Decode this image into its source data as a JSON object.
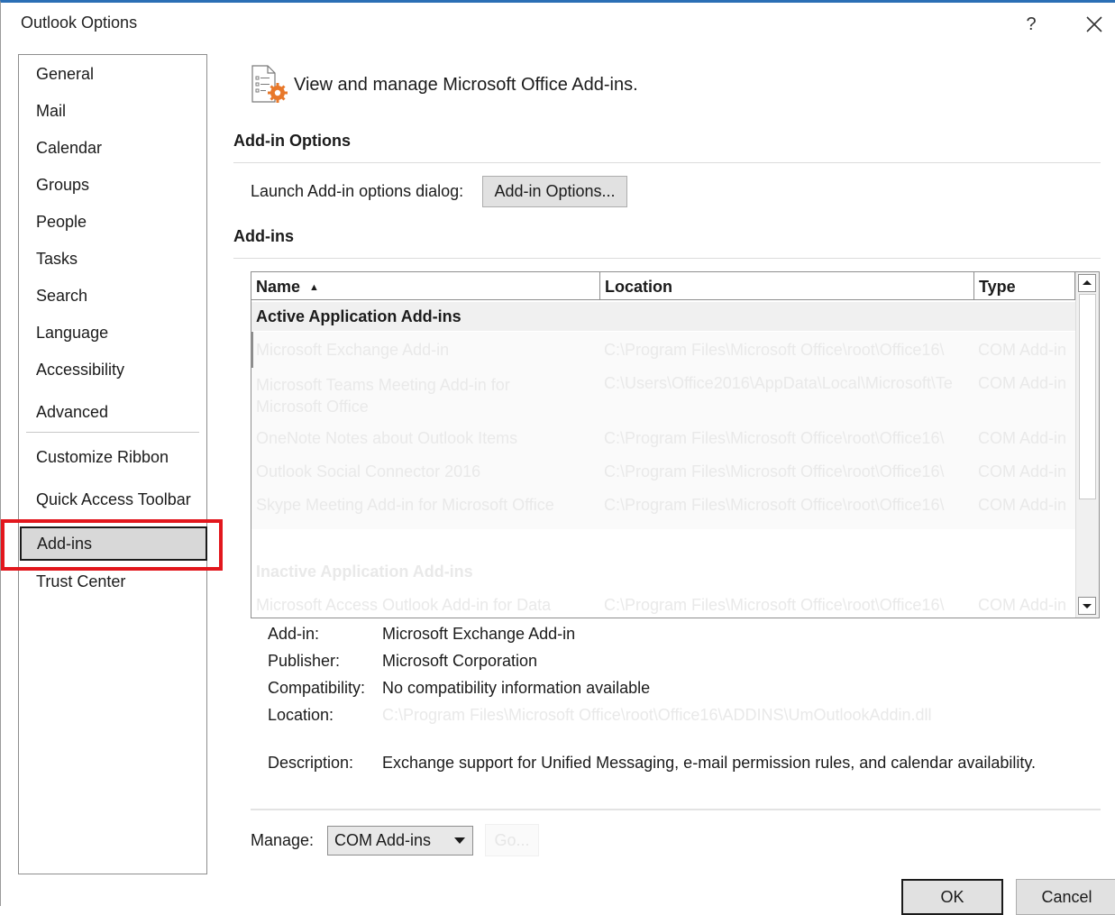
{
  "window": {
    "title": "Outlook Options",
    "help_label": "?",
    "close_label": "✕"
  },
  "nav": {
    "items": [
      {
        "label": "General"
      },
      {
        "label": "Mail"
      },
      {
        "label": "Calendar"
      },
      {
        "label": "Groups"
      },
      {
        "label": "People"
      },
      {
        "label": "Tasks"
      },
      {
        "label": "Search"
      },
      {
        "label": "Language"
      },
      {
        "label": "Accessibility"
      },
      {
        "label": "Advanced"
      },
      {
        "label": "Customize Ribbon"
      },
      {
        "label": "Quick Access Toolbar"
      },
      {
        "label": "Add-ins"
      },
      {
        "label": "Trust Center"
      }
    ],
    "selected": "Add-ins"
  },
  "header": {
    "text": "View and manage Microsoft Office Add-ins."
  },
  "addin_options": {
    "section_title": "Add-in Options",
    "launch_label": "Launch Add-in options dialog:",
    "button_label": "Add-in Options..."
  },
  "addins": {
    "section_title": "Add-ins",
    "columns": [
      "Name",
      "Location",
      "Type"
    ],
    "sort_indicator": "▲",
    "groups": [
      {
        "title": "Active Application Add-ins",
        "rows": [
          {
            "name": "Microsoft Exchange Add-in",
            "location": "C:\\Program Files\\Microsoft Office\\root\\Office16\\",
            "type": "COM Add-in"
          },
          {
            "name": "Microsoft Teams Meeting Add-in for Microsoft Office",
            "location": "C:\\Users\\Office2016\\AppData\\Local\\Microsoft\\Te",
            "type": "COM Add-in"
          },
          {
            "name": "OneNote Notes about Outlook Items",
            "location": "C:\\Program Files\\Microsoft Office\\root\\Office16\\",
            "type": "COM Add-in"
          },
          {
            "name": "Outlook Social Connector 2016",
            "location": "C:\\Program Files\\Microsoft Office\\root\\Office16\\",
            "type": "COM Add-in"
          },
          {
            "name": "Skype Meeting Add-in for Microsoft Office",
            "location": "C:\\Program Files\\Microsoft Office\\root\\Office16\\",
            "type": "COM Add-in"
          }
        ]
      },
      {
        "title": "Inactive Application Add-ins",
        "rows": [
          {
            "name": "Microsoft Access Outlook Add-in for Data",
            "location": "C:\\Program Files\\Microsoft Office\\root\\Office16\\",
            "type": "COM Add-in"
          }
        ]
      }
    ]
  },
  "details": {
    "addin_label": "Add-in:",
    "addin_value": "Microsoft Exchange Add-in",
    "publisher_label": "Publisher:",
    "publisher_value": "Microsoft Corporation",
    "compat_label": "Compatibility:",
    "compat_value": "No compatibility information available",
    "location_label": "Location:",
    "location_value": "C:\\Program Files\\Microsoft Office\\root\\Office16\\ADDINS\\UmOutlookAddin.dll",
    "description_label": "Description:",
    "description_value": "Exchange support for Unified Messaging, e-mail permission rules, and calendar availability."
  },
  "manage": {
    "label": "Manage:",
    "selected": "COM Add-ins",
    "go_label": "Go..."
  },
  "footer": {
    "ok_label": "OK",
    "cancel_label": "Cancel"
  },
  "colors": {
    "highlight": "#e2171d",
    "accent_border": "#2b6fb5",
    "selected_bg": "#d8d8d8"
  }
}
